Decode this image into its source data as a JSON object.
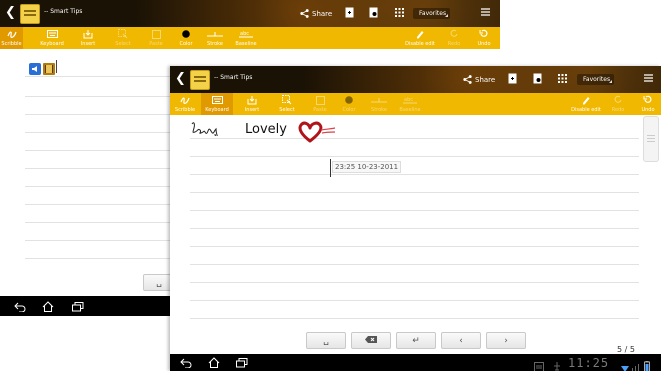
{
  "back_window": {
    "title": "-- Smart Tips",
    "topbar": {
      "share_label": "Share",
      "favorites_label": "Favorites"
    },
    "toolbar": [
      {
        "label": "Scribble",
        "icon": "scribble-icon"
      },
      {
        "label": "Keyboard",
        "icon": "keyboard-icon"
      },
      {
        "label": "Insert",
        "icon": "insert-icon"
      },
      {
        "label": "Select",
        "icon": "select-icon"
      },
      {
        "label": "Paste",
        "icon": "paste-icon"
      },
      {
        "label": "Color",
        "icon": "color-dot-icon"
      },
      {
        "label": "Stroke",
        "icon": "stroke-icon"
      },
      {
        "label": "Baseline",
        "icon": "baseline-icon"
      },
      {
        "label": "Disable edit",
        "icon": "disable-edit-icon"
      },
      {
        "label": "Redo",
        "icon": "redo-icon"
      },
      {
        "label": "Undo",
        "icon": "undo-icon"
      }
    ]
  },
  "front_window": {
    "title": "-- Smart Tips",
    "topbar": {
      "share_label": "Share",
      "favorites_label": "Favorites"
    },
    "toolbar": [
      {
        "label": "Scribble",
        "icon": "scribble-icon"
      },
      {
        "label": "Keyboard",
        "icon": "keyboard-icon"
      },
      {
        "label": "Insert",
        "icon": "insert-icon"
      },
      {
        "label": "Select",
        "icon": "select-icon"
      },
      {
        "label": "Paste",
        "icon": "paste-icon"
      },
      {
        "label": "Color",
        "icon": "color-dot-icon"
      },
      {
        "label": "Stroke",
        "icon": "stroke-icon"
      },
      {
        "label": "Baseline",
        "icon": "baseline-icon"
      },
      {
        "label": "Disable edit",
        "icon": "disable-edit-icon"
      },
      {
        "label": "Redo",
        "icon": "redo-icon"
      },
      {
        "label": "Undo",
        "icon": "undo-icon"
      }
    ],
    "note": {
      "typed_text": "Lovely",
      "timestamp": "23:25 10-23-2011"
    },
    "page_indicator": "5 / 5",
    "keyboard_keys": [
      "space-key",
      "backspace-key",
      "enter-key",
      "prev-key",
      "next-key"
    ],
    "status": {
      "clock": "11:25"
    }
  },
  "colors": {
    "toolbar": "#f0b800",
    "topbar": "#1a1205",
    "navbar": "#000000",
    "scribble_red": "#b0141a"
  }
}
